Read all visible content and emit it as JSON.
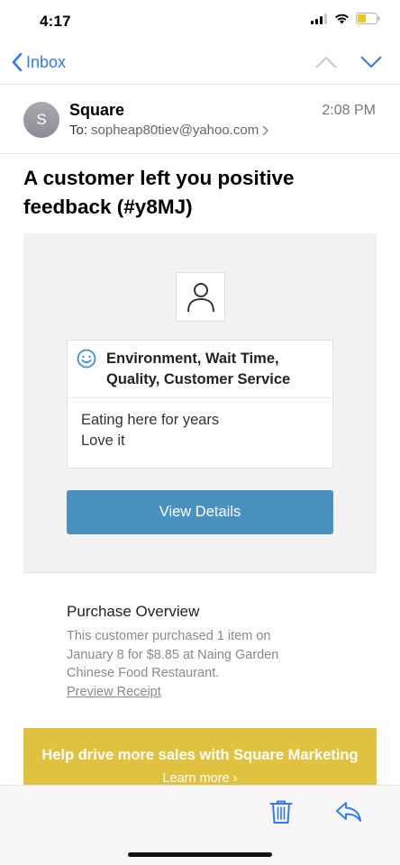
{
  "status_bar": {
    "time": "4:17"
  },
  "nav": {
    "back_label": "Inbox"
  },
  "email": {
    "avatar_letter": "S",
    "sender": "Square",
    "to_label": "To:",
    "to_address": "sopheap80tiev@yahoo.com",
    "time": "2:08 PM",
    "subject": "A customer left you positive feedback (#y8MJ)"
  },
  "feedback": {
    "categories_line1": "Environment, Wait Time,",
    "categories_line2": "Quality, Customer Service",
    "comment_line1": "Eating here for years",
    "comment_line2": "Love it",
    "button_label": "View Details"
  },
  "purchase": {
    "title": "Purchase Overview",
    "line1": "This customer purchased 1 item on",
    "line2": "January 8 for $8.85 at Naing Garden",
    "line3": "Chinese Food Restaurant.",
    "link": "Preview Receipt"
  },
  "promo": {
    "title": "Help drive more sales with Square Marketing",
    "link": "Learn more ›"
  },
  "colors": {
    "accent": "#2f7bf5",
    "button": "#4a90c0",
    "promo": "#e1c240"
  },
  "icons": [
    "back-chevron-icon",
    "up-arrow-icon",
    "down-arrow-icon",
    "person-icon",
    "smile-icon",
    "trash-icon",
    "reply-icon"
  ]
}
